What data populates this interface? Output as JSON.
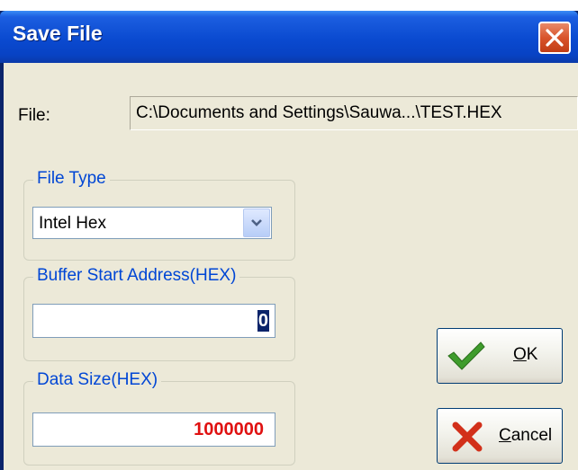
{
  "window": {
    "title": "Save File"
  },
  "file": {
    "label": "File:",
    "path": "C:\\Documents and Settings\\Sauwa...\\TEST.HEX"
  },
  "file_type": {
    "caption": "File Type",
    "selected": "Intel Hex"
  },
  "buffer_start": {
    "caption": "Buffer Start Address(HEX)",
    "value": "0"
  },
  "data_size": {
    "caption": "Data Size(HEX)",
    "value": "1000000"
  },
  "buttons": {
    "ok": {
      "mnemonic": "O",
      "rest": "K"
    },
    "cancel": {
      "mnemonic": "C",
      "rest": "ancel"
    }
  },
  "colors": {
    "title_bar": "#0842c4",
    "caption_text": "#0046d5",
    "data_size_text": "#e01010",
    "dialog_face": "#ece9d8"
  },
  "icons": {
    "close": "close-icon",
    "ok": "checkmark-icon",
    "cancel": "cross-icon",
    "dropdown": "chevron-down-icon"
  }
}
